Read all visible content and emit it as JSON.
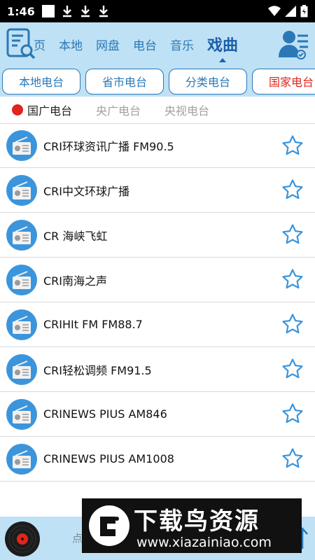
{
  "status_bar": {
    "time": "1:46"
  },
  "nav": {
    "tabs": [
      {
        "label": "页",
        "active": false
      },
      {
        "label": "本地",
        "active": false
      },
      {
        "label": "网盘",
        "active": false
      },
      {
        "label": "电台",
        "active": false
      },
      {
        "label": "音乐",
        "active": false
      },
      {
        "label": "戏曲",
        "active": true
      }
    ]
  },
  "categories": [
    {
      "label": "本地电台",
      "active": false
    },
    {
      "label": "省市电台",
      "active": false
    },
    {
      "label": "分类电台",
      "active": false
    },
    {
      "label": "国家电台",
      "active": true
    }
  ],
  "sub_tabs": [
    {
      "label": "国广电台",
      "active": true
    },
    {
      "label": "央广电台",
      "active": false
    },
    {
      "label": "央视电台",
      "active": false
    }
  ],
  "stations": [
    {
      "name": "CRI环球资讯广播 FM90.5"
    },
    {
      "name": "CRI中文环球广播"
    },
    {
      "name": "CR 海峡飞虹"
    },
    {
      "name": "CRI南海之声"
    },
    {
      "name": "CRIHIt FM FM88.7"
    },
    {
      "name": "CRI轻松调频 FM91.5"
    },
    {
      "name": "CRINEWS PIUS AM846"
    },
    {
      "name": "CRINEWS PIUS AM1008"
    }
  ],
  "player": {
    "text": "点"
  },
  "watermark": {
    "title": "下载鸟资源",
    "url": "www.xiazainiao.com"
  },
  "colors": {
    "accent": "#2b78b6",
    "header_bg": "#bfe1f5",
    "active_red": "#e0251c"
  }
}
